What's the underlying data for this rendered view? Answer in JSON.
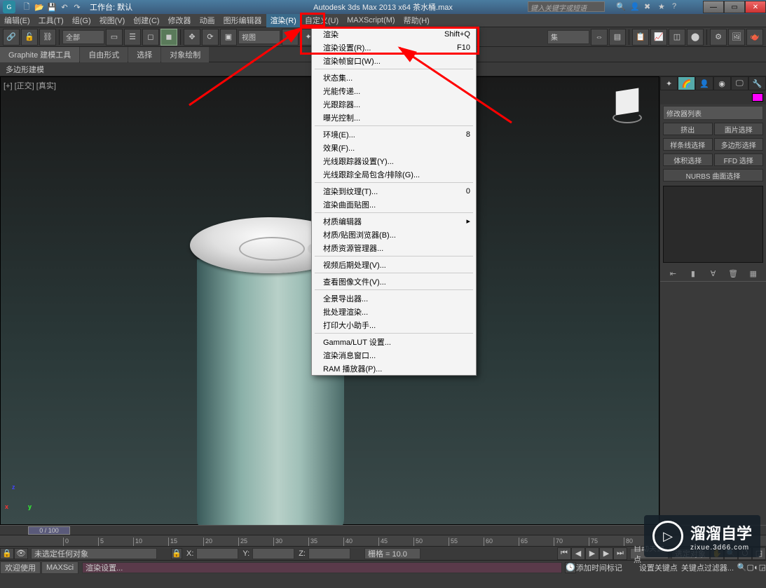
{
  "titlebar": {
    "workspace_label": "工作台: 默认",
    "title": "Autodesk 3ds Max 2013 x64    茶水桶.max",
    "search_placeholder": "键入关键字或短语"
  },
  "menubar": {
    "items": [
      "编辑(E)",
      "工具(T)",
      "组(G)",
      "视图(V)",
      "创建(C)",
      "修改器",
      "动画",
      "图形编辑器",
      "渲染(R)",
      "自定义(U)",
      "MAXScript(M)",
      "帮助(H)"
    ]
  },
  "toolbar": {
    "sel_all": "全部",
    "sel_view": "视图"
  },
  "ribbon": {
    "tabs": [
      "Graphite 建模工具",
      "自由形式",
      "选择",
      "对象绘制"
    ],
    "sub": "多边形建模"
  },
  "viewport": {
    "label": "[+] [正交] [真实]"
  },
  "dropdown": {
    "items": [
      {
        "label": "渲染",
        "shortcut": "Shift+Q",
        "type": "item"
      },
      {
        "label": "渲染设置(R)...",
        "shortcut": "F10",
        "type": "item",
        "highlight": true
      },
      {
        "label": "渲染帧窗口(W)...",
        "shortcut": "",
        "type": "item"
      },
      {
        "type": "sep"
      },
      {
        "label": "状态集...",
        "shortcut": "",
        "type": "item"
      },
      {
        "label": "光能传递...",
        "shortcut": "",
        "type": "item"
      },
      {
        "label": "光跟踪器...",
        "shortcut": "",
        "type": "item"
      },
      {
        "label": "曝光控制...",
        "shortcut": "",
        "type": "item"
      },
      {
        "type": "sep"
      },
      {
        "label": "环境(E)...",
        "shortcut": "8",
        "type": "item"
      },
      {
        "label": "效果(F)...",
        "shortcut": "",
        "type": "item"
      },
      {
        "label": "光线跟踪器设置(Y)...",
        "shortcut": "",
        "type": "item"
      },
      {
        "label": "光线跟踪全局包含/排除(G)...",
        "shortcut": "",
        "type": "item"
      },
      {
        "type": "sep"
      },
      {
        "label": "渲染到纹理(T)...",
        "shortcut": "0",
        "type": "item"
      },
      {
        "label": "渲染曲面贴图...",
        "shortcut": "",
        "type": "item"
      },
      {
        "type": "sep"
      },
      {
        "label": "材质编辑器",
        "shortcut": "",
        "type": "item",
        "arrow": true
      },
      {
        "label": "材质/贴图浏览器(B)...",
        "shortcut": "",
        "type": "item"
      },
      {
        "label": "材质资源管理器...",
        "shortcut": "",
        "type": "item"
      },
      {
        "type": "sep"
      },
      {
        "label": "视频后期处理(V)...",
        "shortcut": "",
        "type": "item"
      },
      {
        "type": "sep"
      },
      {
        "label": "查看图像文件(V)...",
        "shortcut": "",
        "type": "item"
      },
      {
        "type": "sep"
      },
      {
        "label": "全景导出器...",
        "shortcut": "",
        "type": "item"
      },
      {
        "label": "批处理渲染...",
        "shortcut": "",
        "type": "item"
      },
      {
        "label": "打印大小助手...",
        "shortcut": "",
        "type": "item"
      },
      {
        "type": "sep"
      },
      {
        "label": "Gamma/LUT 设置...",
        "shortcut": "",
        "type": "item"
      },
      {
        "label": "渲染消息窗口...",
        "shortcut": "",
        "type": "item"
      },
      {
        "label": "RAM 播放器(P)...",
        "shortcut": "",
        "type": "item"
      }
    ]
  },
  "rpanel": {
    "modifier_label": "修改器列表",
    "btns": [
      "挤出",
      "面片选择",
      "样条线选择",
      "多边形选择",
      "体积选择",
      "FFD 选择",
      "NURBS 曲面选择"
    ]
  },
  "timeline": {
    "pos": "0 / 100",
    "ticks": [
      "0",
      "5",
      "10",
      "15",
      "20",
      "25",
      "30",
      "35",
      "40",
      "45",
      "50",
      "55",
      "60",
      "65",
      "70",
      "75",
      "80"
    ]
  },
  "status1": {
    "selection": "未选定任何对象",
    "x": "X:",
    "y": "Y:",
    "z": "Z:",
    "grid": "栅格 = 10.0",
    "autokey": "自动关键点",
    "selset": "选定对象"
  },
  "status2": {
    "tabs": [
      "欢迎使用",
      "MAXSci"
    ],
    "prompt": "渲染设置...",
    "addtime": "添加时间标记",
    "setkey": "设置关键点",
    "keyfilter": "关键点过滤器..."
  },
  "watermark": {
    "cn": "溜溜自学",
    "url": "zixue.3d66.com"
  }
}
